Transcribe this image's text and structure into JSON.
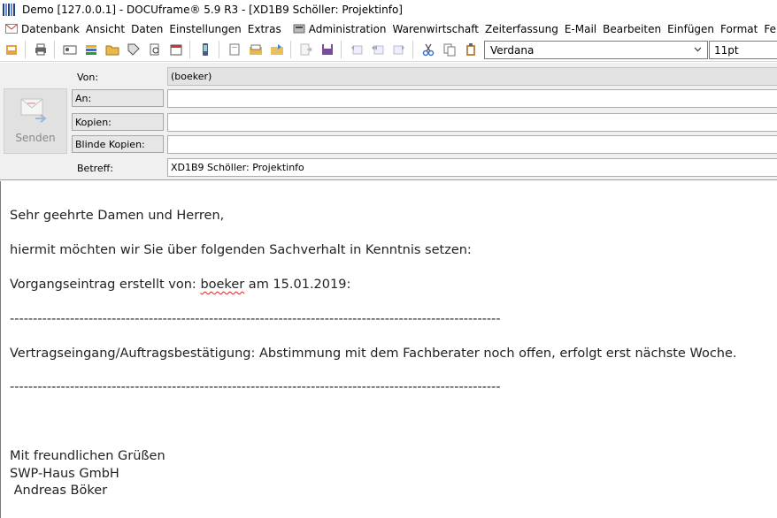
{
  "window": {
    "title": "Demo [127.0.0.1] - DOCUframe® 5.9 R3 - [XD1B9 Schöller: Projektinfo]"
  },
  "menubar": {
    "items": [
      {
        "label": "Datenbank",
        "icon": "mail-envelope-icon"
      },
      {
        "label": "Ansicht"
      },
      {
        "label": "Daten"
      },
      {
        "label": "Einstellungen"
      },
      {
        "label": "Extras"
      },
      {
        "label": "Administration",
        "icon": "admin-icon"
      },
      {
        "label": "Warenwirtschaft"
      },
      {
        "label": "Zeiterfassung"
      },
      {
        "label": "E-Mail"
      },
      {
        "label": "Bearbeiten"
      },
      {
        "label": "Einfügen"
      },
      {
        "label": "Format"
      },
      {
        "label": "Fe"
      }
    ]
  },
  "toolbar": {
    "font_name": "Verdana",
    "font_size": "11pt"
  },
  "header": {
    "send_label": "Senden",
    "from_label": "Von:",
    "from_value": "(boeker)",
    "to_label": "An:",
    "to_value": "",
    "cc_label": "Kopien:",
    "cc_value": "",
    "bcc_label": "Blinde Kopien:",
    "bcc_value": "",
    "subject_label": "Betreff:",
    "subject_value": "XD1B9 Schöller: Projektinfo"
  },
  "body": {
    "greeting": "Sehr geehrte Damen und Herren,",
    "intro": "hiermit möchten wir Sie über folgenden Sachverhalt in Kenntnis setzen:",
    "entry_prefix": "Vorgangseintrag erstellt von: ",
    "entry_user": "boeker",
    "entry_suffix": " am 15.01.2019:",
    "separator1": "----------------------------------------------------------------------------------------------------------",
    "content": "Vertragseingang/Auftragsbestätigung: Abstimmung mit dem Fachberater noch offen, erfolgt erst nächste Woche.",
    "separator2": "----------------------------------------------------------------------------------------------------------",
    "closing": "Mit freundlichen Grüßen",
    "company": "SWP-Haus GmbH",
    "signature": " Andreas Böker"
  }
}
